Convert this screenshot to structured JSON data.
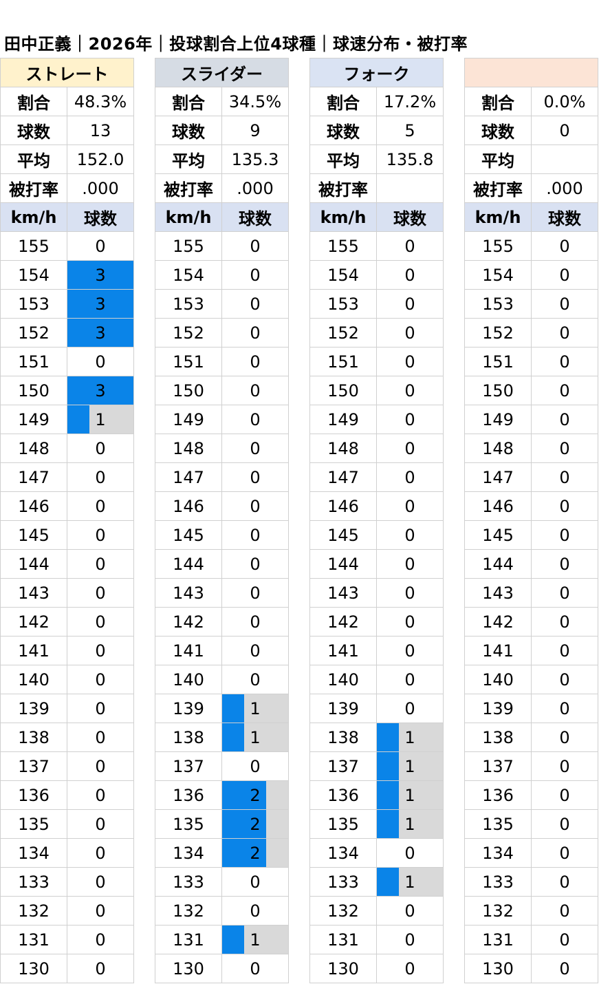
{
  "title": "田中正義｜2026年｜投球割合上位4球種｜球速分布・被打率",
  "stat_labels": {
    "ratio": "割合",
    "count": "球数",
    "avg": "平均",
    "bavg": "被打率"
  },
  "table_headers": {
    "speed": "km/h",
    "count": "球数"
  },
  "colors": {
    "bar": "#0a84e8",
    "bar_track": "#d9d9d9",
    "header_row": "#d9e1f2",
    "grid": "#d0d0d0"
  },
  "bar_scale_max": 3,
  "chart_data": {
    "type": "table",
    "speeds": [
      "155",
      "154",
      "153",
      "152",
      "151",
      "150",
      "149",
      "148",
      "147",
      "146",
      "145",
      "144",
      "143",
      "142",
      "141",
      "140",
      "139",
      "138",
      "137",
      "136",
      "135",
      "134",
      "133",
      "132",
      "131",
      "130"
    ],
    "pitches": [
      {
        "name": "ストレート",
        "color": "#fff2cc",
        "ratio": "48.3%",
        "count": "13",
        "avg": "152.0",
        "bavg": ".000",
        "counts": [
          0,
          3,
          3,
          3,
          0,
          3,
          1,
          0,
          0,
          0,
          0,
          0,
          0,
          0,
          0,
          0,
          0,
          0,
          0,
          0,
          0,
          0,
          0,
          0,
          0,
          0
        ]
      },
      {
        "name": "スライダー",
        "color": "#d6dce4",
        "ratio": "34.5%",
        "count": "9",
        "avg": "135.3",
        "bavg": ".000",
        "counts": [
          0,
          0,
          0,
          0,
          0,
          0,
          0,
          0,
          0,
          0,
          0,
          0,
          0,
          0,
          0,
          0,
          1,
          1,
          0,
          2,
          2,
          2,
          0,
          0,
          1,
          0
        ]
      },
      {
        "name": "フォーク",
        "color": "#dae3f3",
        "ratio": "17.2%",
        "count": "5",
        "avg": "135.8",
        "bavg": "",
        "counts": [
          0,
          0,
          0,
          0,
          0,
          0,
          0,
          0,
          0,
          0,
          0,
          0,
          0,
          0,
          0,
          0,
          0,
          1,
          1,
          1,
          1,
          0,
          1,
          0,
          0,
          0
        ]
      },
      {
        "name": "",
        "color": "#fce4d6",
        "ratio": "0.0%",
        "count": "0",
        "avg": "",
        "bavg": ".000",
        "counts": [
          0,
          0,
          0,
          0,
          0,
          0,
          0,
          0,
          0,
          0,
          0,
          0,
          0,
          0,
          0,
          0,
          0,
          0,
          0,
          0,
          0,
          0,
          0,
          0,
          0,
          0
        ]
      }
    ]
  }
}
